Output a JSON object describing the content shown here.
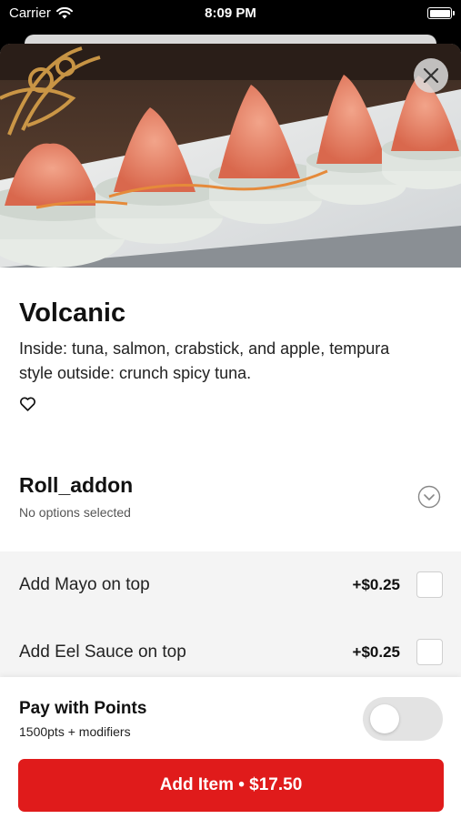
{
  "status_bar": {
    "carrier": "Carrier",
    "time": "8:09 PM"
  },
  "item": {
    "title": "Volcanic",
    "description": "Inside: tuna, salmon, crabstick, and apple, tempura style outside: crunch spicy tuna."
  },
  "modifier_group": {
    "title": "Roll_addon",
    "subtitle": "No options selected",
    "options": [
      {
        "label": "Add Mayo on top",
        "price": "+$0.25",
        "checked": false
      },
      {
        "label": "Add Eel Sauce on top",
        "price": "+$0.25",
        "checked": false
      }
    ]
  },
  "points": {
    "title": "Pay with Points",
    "subtitle": "1500pts + modifiers",
    "enabled": false
  },
  "add_button": {
    "label": "Add Item • $17.50"
  },
  "colors": {
    "accent": "#e01b1b",
    "toggle_off": "#e3e3e3",
    "options_bg": "#f4f4f4"
  },
  "icons": [
    "wifi-icon",
    "battery-icon",
    "close-icon",
    "heart-icon",
    "chevron-down-circle-icon"
  ]
}
